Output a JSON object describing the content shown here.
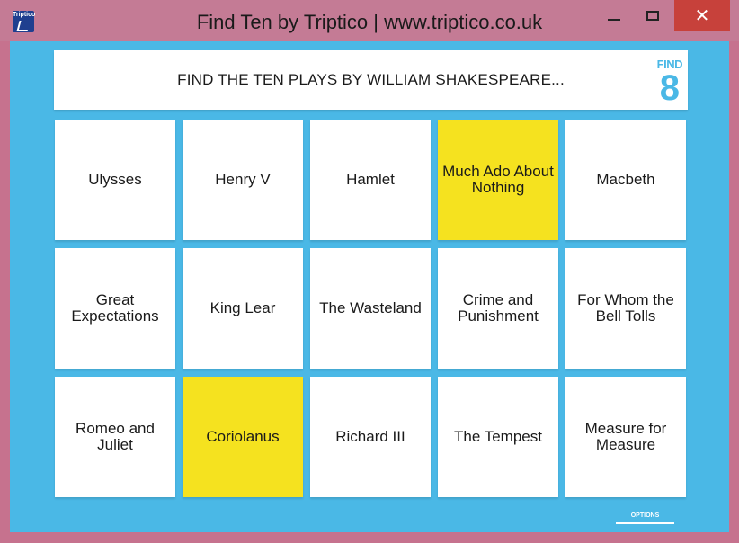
{
  "window": {
    "title": "Find Ten by Triptico | www.triptico.co.uk",
    "icon_label": "Triptico",
    "close_glyph": "✕"
  },
  "game": {
    "question": "FIND THE TEN PLAYS BY WILLIAM SHAKESPEARE...",
    "find_label": "FIND",
    "remaining": "8",
    "tiles": [
      {
        "label": "Ulysses",
        "selected": false
      },
      {
        "label": "Henry V",
        "selected": false
      },
      {
        "label": "Hamlet",
        "selected": false
      },
      {
        "label": "Much Ado About Nothing",
        "selected": true
      },
      {
        "label": "Macbeth",
        "selected": false
      },
      {
        "label": "Great Expectations",
        "selected": false
      },
      {
        "label": "King Lear",
        "selected": false
      },
      {
        "label": "The Wasteland",
        "selected": false
      },
      {
        "label": "Crime and Punishment",
        "selected": false
      },
      {
        "label": "For Whom the Bell Tolls",
        "selected": false
      },
      {
        "label": "Romeo and Juliet",
        "selected": false
      },
      {
        "label": "Coriolanus",
        "selected": true
      },
      {
        "label": "Richard III",
        "selected": false
      },
      {
        "label": "The Tempest",
        "selected": false
      },
      {
        "label": "Measure for Measure",
        "selected": false
      }
    ],
    "options_label": "OPTIONS"
  },
  "colors": {
    "frame": "#4ab8e6",
    "titlebar": "#c47b95",
    "selected_tile": "#f5e21f",
    "tile": "#ffffff",
    "close_button": "#c7413b"
  }
}
